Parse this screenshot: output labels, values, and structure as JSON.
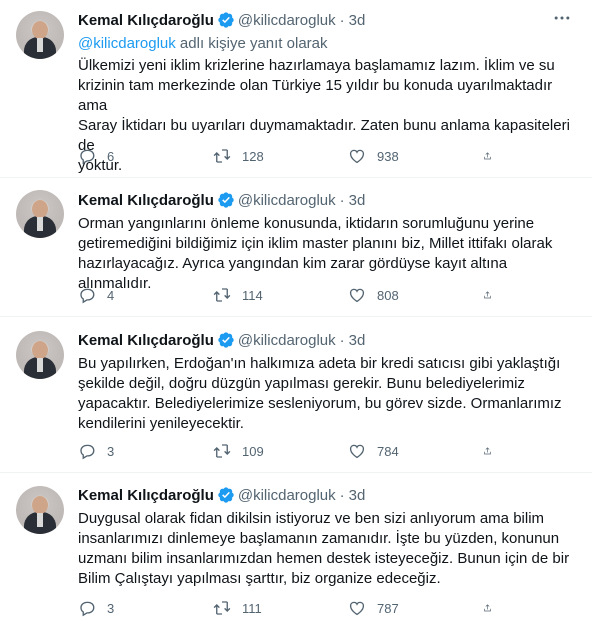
{
  "tweets": [
    {
      "name": "Kemal Kılıçdaroğlu",
      "handle": "@kilicdarogluk",
      "time": "3d",
      "reply_handle": "@kilicdarogluk",
      "reply_suffix": " adlı kişiye yanıt olarak",
      "text_lines": [
        "Ülkemizi yeni iklim krizlerine hazırlamaya başlamamız lazım. İklim ve su",
        "krizinin tam merkezinde olan Türkiye 15 yıldır bu konuda uyarılmaktadır ama",
        "Saray İktidarı bu uyarıları duymamaktadır. Zaten bunu anlama kapasiteleri de",
        "yoktur."
      ],
      "replies": "6",
      "retweets": "128",
      "likes": "938"
    },
    {
      "name": "Kemal Kılıçdaroğlu",
      "handle": "@kilicdarogluk",
      "time": "3d",
      "text_lines": [
        "Orman yangınlarını önleme konusunda, iktidarın sorumluğunu yerine",
        "getiremediğini bildiğimiz için iklim master planını biz, Millet ittifakı olarak",
        "hazırlayacağız. Ayrıca yangından kim zarar gördüyse kayıt altına alınmalıdır."
      ],
      "replies": "4",
      "retweets": "114",
      "likes": "808"
    },
    {
      "name": "Kemal Kılıçdaroğlu",
      "handle": "@kilicdarogluk",
      "time": "3d",
      "text_lines": [
        "Bu yapılırken, Erdoğan'ın halkımıza adeta bir kredi satıcısı gibi yaklaştığı",
        "şekilde değil, doğru düzgün yapılması gerekir. Bunu belediyelerimiz",
        "yapacaktır. Belediyelerimize sesleniyorum, bu görev sizde. Ormanlarımız",
        "kendilerini yenileyecektir."
      ],
      "replies": "3",
      "retweets": "109",
      "likes": "784"
    },
    {
      "name": "Kemal Kılıçdaroğlu",
      "handle": "@kilicdarogluk",
      "time": "3d",
      "text_lines": [
        "Duygusal olarak fidan dikilsin istiyoruz ve ben sizi anlıyorum ama bilim",
        "insanlarımızı dinlemeye başlamanın zamanıdır. İşte bu yüzden, konunun",
        "uzmanı bilim insanlarımızdan hemen destek isteyeceğiz. Bunun için de bir",
        "Bilim Çalıştayı yapılması şarttır, biz organize edeceğiz."
      ],
      "replies": "3",
      "retweets": "111",
      "likes": "787"
    }
  ],
  "colors": {
    "accent": "#1d9bf0",
    "secondary_text": "#536471",
    "divider": "#eff3f4"
  },
  "icons": [
    "verified-badge-icon",
    "more-icon",
    "reply-icon",
    "retweet-icon",
    "like-icon",
    "share-icon"
  ]
}
